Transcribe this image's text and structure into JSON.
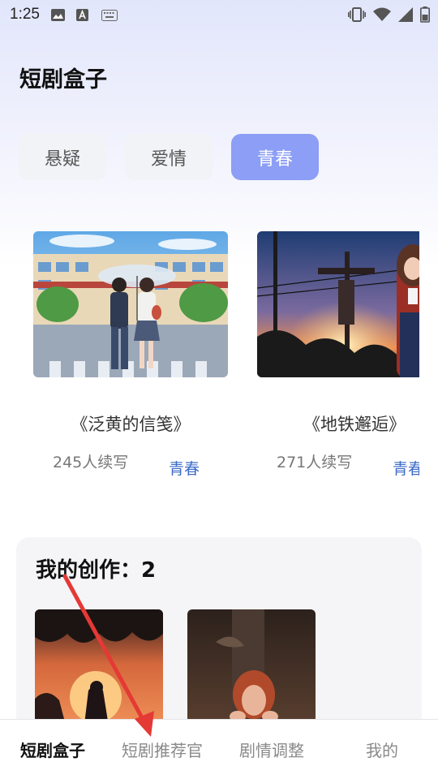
{
  "status_bar": {
    "time": "1:25",
    "left_icons": [
      "image-icon",
      "font-a-icon",
      "keyboard-icon"
    ],
    "right_icons": [
      "vibrate-icon",
      "wifi-icon",
      "signal-icon",
      "battery-icon"
    ]
  },
  "header": {
    "title": "短剧盒子"
  },
  "tabs": [
    {
      "label": "悬疑",
      "active": false
    },
    {
      "label": "爱情",
      "active": false
    },
    {
      "label": "青春",
      "active": true
    }
  ],
  "cards": [
    {
      "title": "《泛黄的信笺》",
      "count": "245人续写",
      "tag": "青春"
    },
    {
      "title": "《地铁邂逅》",
      "count": "271人续写",
      "tag": "青春"
    }
  ],
  "my_works": {
    "title": "我的创作：2"
  },
  "nav": [
    {
      "label": "短剧盒子",
      "active": true
    },
    {
      "label": "短剧推荐官",
      "active": false
    },
    {
      "label": "剧情调整",
      "active": false
    },
    {
      "label": "我的",
      "active": false
    }
  ],
  "colors": {
    "accent": "#8c9ef5",
    "tag_blue": "#3d6bc9",
    "annotation_arrow": "#e53935"
  }
}
